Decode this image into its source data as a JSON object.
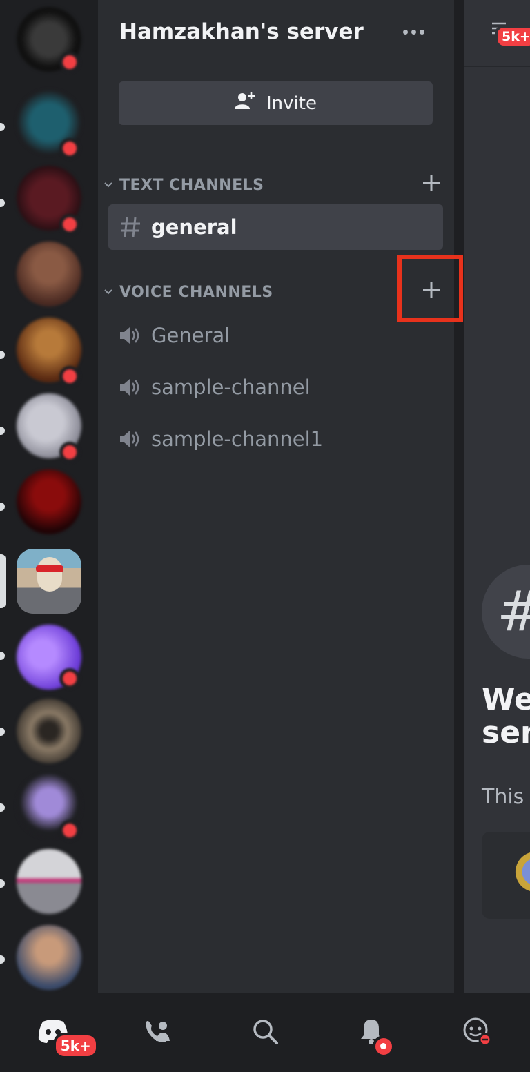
{
  "server": {
    "name": "Hamzakhan's server"
  },
  "invite": {
    "label": "Invite"
  },
  "categories": [
    {
      "label": "TEXT CHANNELS"
    },
    {
      "label": "VOICE CHANNELS"
    }
  ],
  "text_channels": [
    {
      "name": "general",
      "active": true
    }
  ],
  "voice_channels": [
    {
      "name": "General"
    },
    {
      "name": "sample-channel"
    },
    {
      "name": "sample-channel1"
    }
  ],
  "chat_peek": {
    "welcome_line1": "We",
    "welcome_line2": "ser",
    "subtitle": "This",
    "topbar_badge": "5k+"
  },
  "nav": {
    "home_badge": "5k+",
    "items": [
      "home",
      "friends",
      "search",
      "notifications",
      "you"
    ]
  },
  "colors": {
    "highlight_box": "#e8321c",
    "badge": "#f23f43",
    "panel": "#2b2d31",
    "rail": "#1e1f22",
    "selected_channel": "#404249"
  },
  "icons": {
    "server_menu": "more-horizontal-icon",
    "invite": "add-person-icon",
    "text_channel": "hash-icon",
    "voice_channel": "speaker-icon",
    "add_channel": "plus-icon",
    "collapse": "chevron-down-icon"
  }
}
